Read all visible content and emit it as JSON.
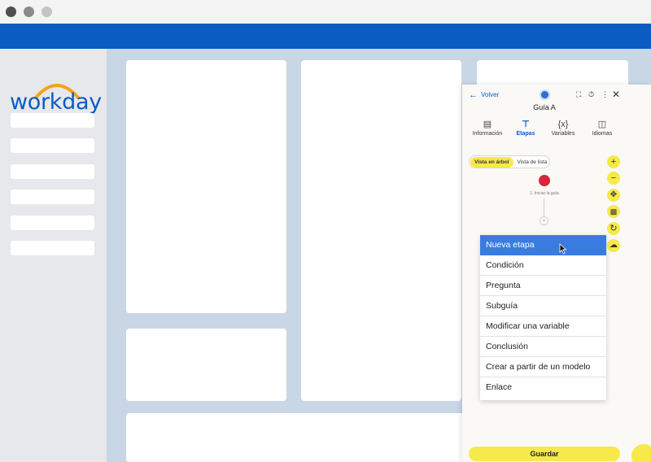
{
  "app": {
    "brand": "workday",
    "colors": {
      "brand_blue": "#0b5cc2",
      "accent_yellow": "#f7e94a",
      "highlight_blue": "#3a7be0",
      "start_node_red": "#d7263d"
    }
  },
  "panel": {
    "back_label": "Volver",
    "guide_title": "Guía A",
    "tabs": [
      {
        "label": "Información",
        "icon": "document-icon"
      },
      {
        "label": "Etapas",
        "icon": "tree-icon",
        "active": true
      },
      {
        "label": "Variables",
        "icon": "variables-icon"
      },
      {
        "label": "Idiomas",
        "icon": "languages-icon"
      }
    ],
    "view_toggle": {
      "tree": "Vista en árbol",
      "list": "Vista de lista",
      "selected": "Vista en árbol"
    },
    "start_node_label": "1. Iniciar la guía",
    "save_label": "Guardar"
  },
  "menu": {
    "items": [
      "Nueva etapa",
      "Condición",
      "Pregunta",
      "Subguía",
      "Modificar una variable",
      "Conclusión",
      "Crear a partir de un modelo",
      "Enlace"
    ],
    "highlighted": "Nueva etapa"
  }
}
